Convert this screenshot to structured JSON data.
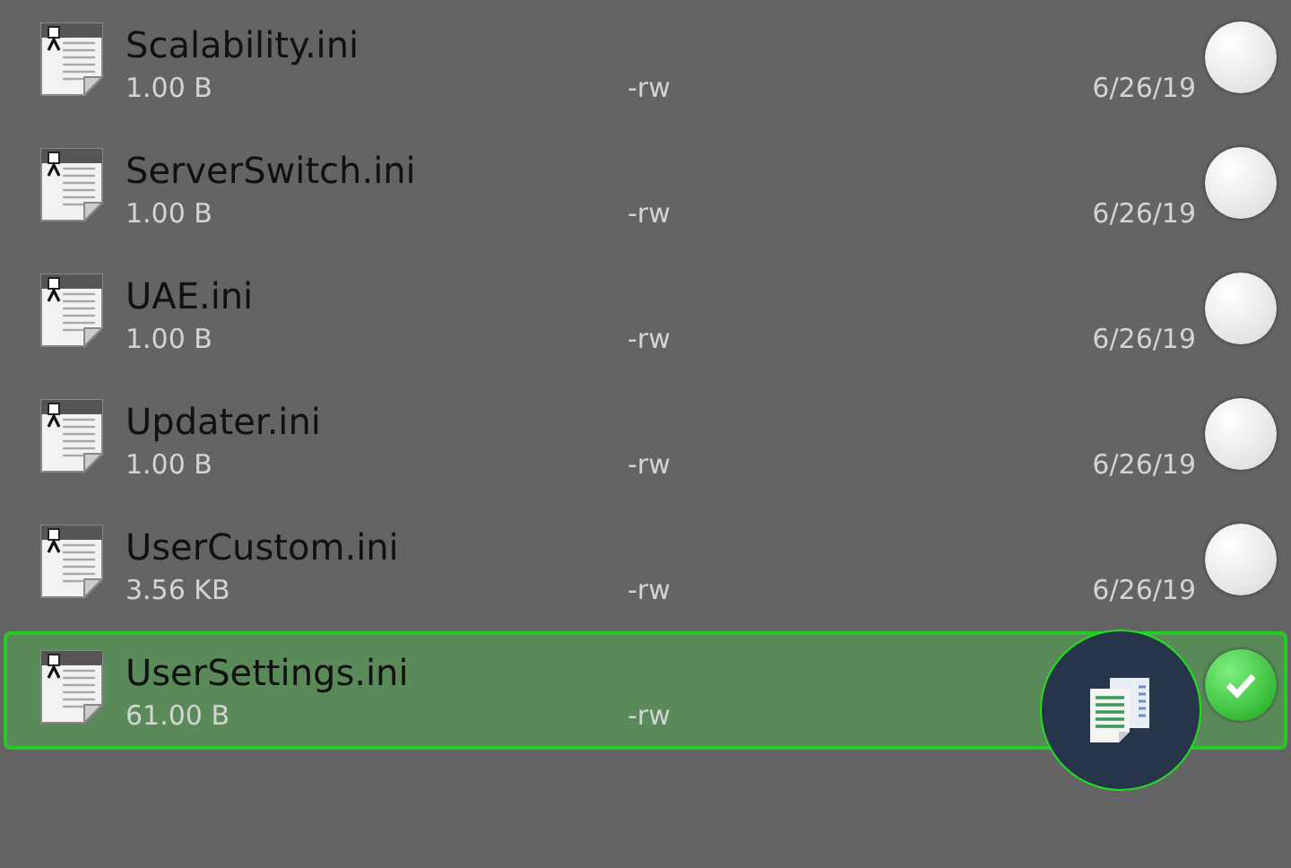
{
  "files": [
    {
      "name": "Scalability.ini",
      "size": "1.00 B",
      "permissions": "-rw",
      "date": "6/26/19",
      "selected": false
    },
    {
      "name": "ServerSwitch.ini",
      "size": "1.00 B",
      "permissions": "-rw",
      "date": "6/26/19",
      "selected": false
    },
    {
      "name": "UAE.ini",
      "size": "1.00 B",
      "permissions": "-rw",
      "date": "6/26/19",
      "selected": false
    },
    {
      "name": "Updater.ini",
      "size": "1.00 B",
      "permissions": "-rw",
      "date": "6/26/19",
      "selected": false
    },
    {
      "name": "UserCustom.ini",
      "size": "3.56 KB",
      "permissions": "-rw",
      "date": "6/26/19",
      "selected": false
    },
    {
      "name": "UserSettings.ini",
      "size": "61.00 B",
      "permissions": "-rw",
      "selected": true
    }
  ]
}
